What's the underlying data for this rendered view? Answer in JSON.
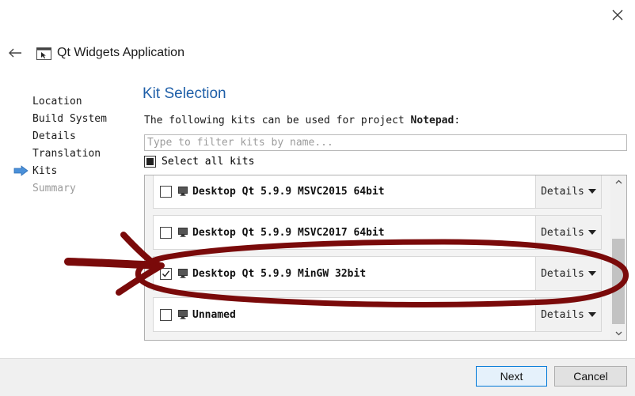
{
  "window": {
    "wizard_title": "Qt Widgets Application"
  },
  "steps": [
    {
      "label": "Location",
      "state": "done"
    },
    {
      "label": "Build System",
      "state": "done"
    },
    {
      "label": "Details",
      "state": "done"
    },
    {
      "label": "Translation",
      "state": "done"
    },
    {
      "label": "Kits",
      "state": "current"
    },
    {
      "label": "Summary",
      "state": "pending"
    }
  ],
  "page": {
    "title": "Kit Selection",
    "intro_prefix": "The following kits can be used for project ",
    "project_name": "Notepad",
    "intro_suffix": ":",
    "filter_placeholder": "Type to filter kits by name...",
    "filter_value": "",
    "select_all_label": "Select all kits",
    "select_all_state": "partial"
  },
  "kits": [
    {
      "name": "Desktop Qt 5.9.9 MSVC2015 64bit",
      "checked": false,
      "details_label": "Details",
      "icon": "monitor-icon"
    },
    {
      "name": "Desktop Qt 5.9.9 MSVC2017 64bit",
      "checked": false,
      "details_label": "Details",
      "icon": "monitor-icon"
    },
    {
      "name": "Desktop Qt 5.9.9 MinGW 32bit",
      "checked": true,
      "details_label": "Details",
      "icon": "monitor-icon"
    },
    {
      "name": "Unnamed",
      "checked": false,
      "details_label": "Details",
      "icon": "monitor-icon"
    }
  ],
  "buttons": {
    "next_label": "Next",
    "cancel_label": "Cancel"
  },
  "colors": {
    "title_blue": "#1f5fa8",
    "annotation_red": "#7a0a0a",
    "step_arrow_blue": "#4a90d9"
  }
}
